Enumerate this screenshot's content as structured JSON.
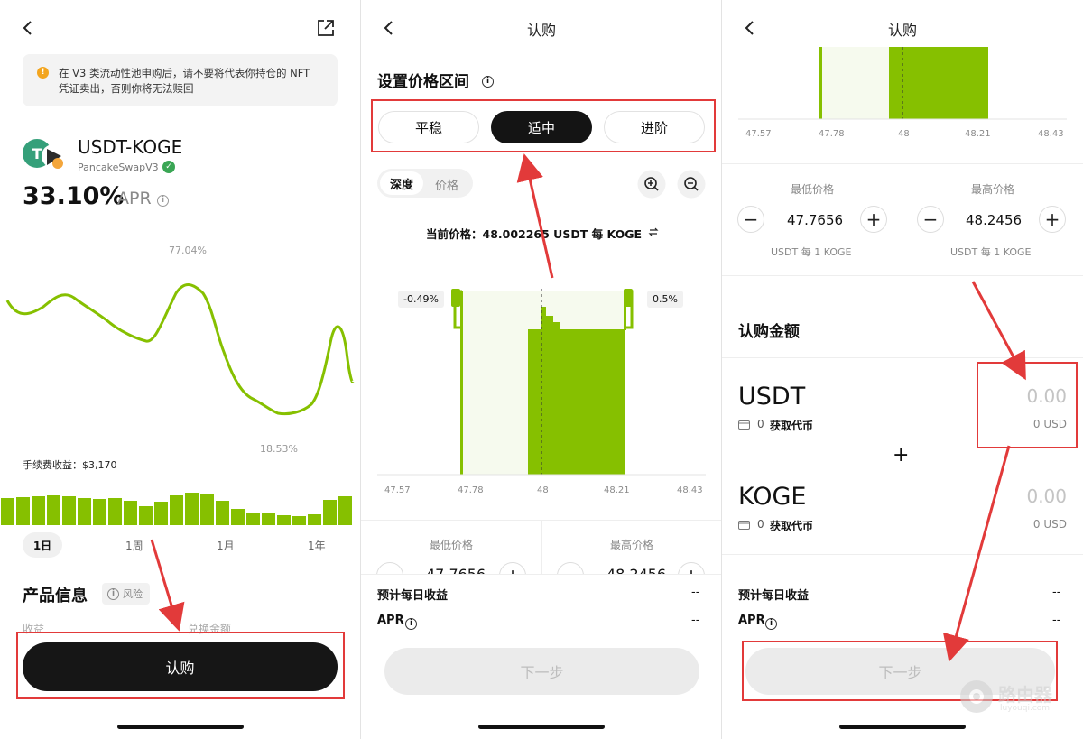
{
  "panel1": {
    "notice": "在 V3 类流动性池申购后，请不要将代表你持仓的 NFT 凭证卖出，否则你将无法赎回",
    "pair": "USDT-KOGE",
    "source": "PancakeSwapV3",
    "apr_value": "33.10%",
    "apr_label": "APR",
    "chart_max_label": "77.04%",
    "chart_min_label": "18.53%",
    "fee_label": "手续费收益：$3,170",
    "periods": [
      "1日",
      "1周",
      "1月",
      "1年"
    ],
    "product_info": "产品信息",
    "risk": "风险",
    "hidden_row_left": "收益",
    "hidden_row_right": "兑换金额",
    "subscribe": "认购"
  },
  "panel2": {
    "title": "认购",
    "section": "设置价格区间",
    "modes": [
      "平稳",
      "适中",
      "进阶"
    ],
    "view_tabs": [
      "深度",
      "价格"
    ],
    "current_price": "当前价格：48.002265 USDT 每 KOGE",
    "low_pct": "-0.49%",
    "high_pct": "0.5%",
    "ticks": [
      "47.57",
      "47.78",
      "48",
      "48.21",
      "48.43"
    ],
    "min_label": "最低价格",
    "max_label": "最高价格",
    "min_value": "47.7656",
    "max_value": "48.2456",
    "daily": "预计每日收益",
    "daily_val": "--",
    "apr": "APR",
    "apr_val": "--",
    "next": "下一步"
  },
  "panel3": {
    "title": "认购",
    "ticks": [
      "47.57",
      "47.78",
      "48",
      "48.21",
      "48.43"
    ],
    "min_label": "最低价格",
    "max_label": "最高价格",
    "min_value": "47.7656",
    "max_value": "48.2456",
    "unit": "USDT 每 1 KOGE",
    "amount_title": "认购金额",
    "token1": "USDT",
    "token2": "KOGE",
    "balance": "0",
    "get_token": "获取代币",
    "amount_placeholder": "0.00",
    "usd": "0 USD",
    "plus": "+",
    "daily": "预计每日收益",
    "daily_val": "--",
    "apr": "APR",
    "apr_val": "--",
    "next": "下一步"
  },
  "watermark": {
    "name": "路由器",
    "url": "luyouqi.com"
  },
  "colors": {
    "accent": "#86c000",
    "annotation": "#e23a3a",
    "dark_button": "#141414"
  }
}
